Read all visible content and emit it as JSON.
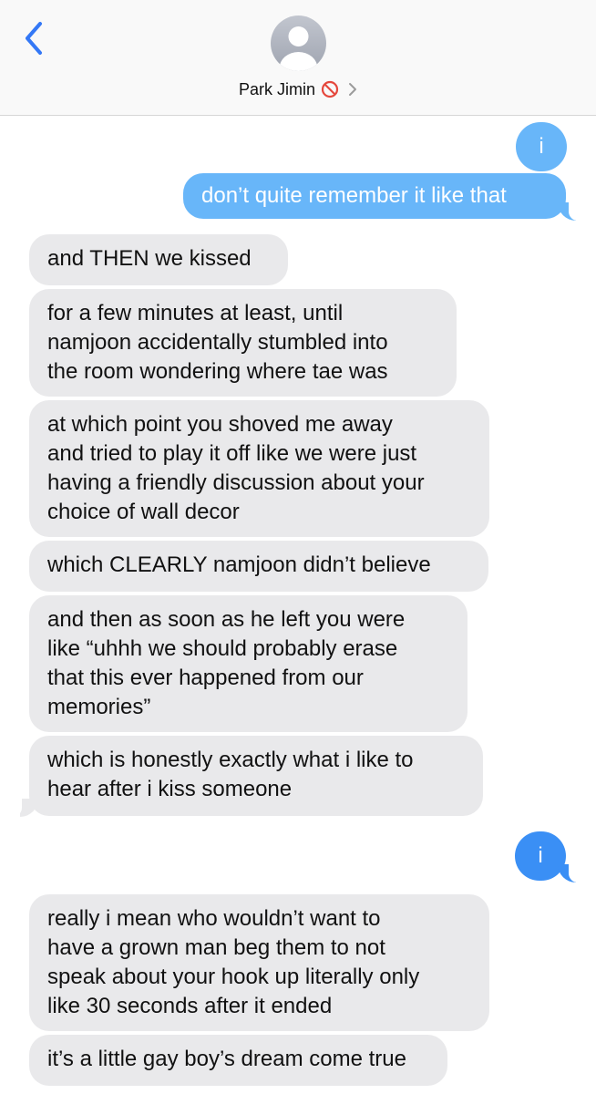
{
  "header": {
    "contact_name": "Park Jimin",
    "back_icon": "chevron-left-icon",
    "blocked_icon": "blocked-icon",
    "chevron_icon": "chevron-right-icon"
  },
  "colors": {
    "sent_light": "#68b6f9",
    "sent_blue": "#3a8ff5",
    "received": "#e9e9eb",
    "back_tint": "#3478f6"
  },
  "messages": [
    {
      "direction": "sent",
      "text": "i"
    },
    {
      "direction": "sent",
      "text": "don’t quite remember it like that"
    },
    {
      "direction": "received",
      "text": "and THEN we kissed"
    },
    {
      "direction": "received",
      "lines": [
        "for a few minutes at least, until",
        "namjoon accidentally stumbled into",
        "the room wondering where tae was"
      ]
    },
    {
      "direction": "received",
      "lines": [
        "at which point you shoved me away",
        "and tried to play it off like we were just",
        "having a friendly discussion about your",
        "choice of wall decor"
      ]
    },
    {
      "direction": "received",
      "text": "which CLEARLY namjoon didn’t believe"
    },
    {
      "direction": "received",
      "lines": [
        "and then as soon as he left you were",
        "like “uhhh we should probably erase",
        "that this ever happened from our",
        "memories”"
      ]
    },
    {
      "direction": "received",
      "lines": [
        "which is honestly exactly what i like to",
        "hear after i kiss someone"
      ]
    },
    {
      "direction": "sent",
      "text": "i"
    },
    {
      "direction": "received",
      "lines": [
        "really i mean who wouldn’t want to",
        "have a grown man beg them to not",
        "speak about your hook up literally only",
        "like 30 seconds after it ended"
      ]
    },
    {
      "direction": "received",
      "text": "it’s a little gay boy’s dream come true"
    }
  ]
}
